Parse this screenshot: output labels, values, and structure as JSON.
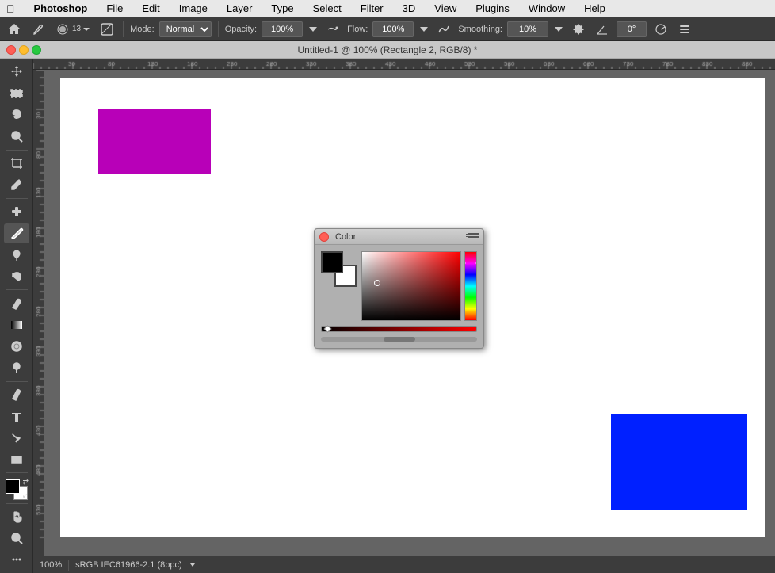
{
  "menubar": {
    "items": [
      "Photoshop",
      "File",
      "Edit",
      "Image",
      "Layer",
      "Type",
      "Select",
      "Filter",
      "3D",
      "View",
      "Plugins",
      "Window",
      "Help"
    ]
  },
  "optionsbar": {
    "brush_icon": "brush",
    "brush_size": "13",
    "mode_label": "Mode:",
    "mode_value": "Normal",
    "opacity_label": "Opacity:",
    "opacity_value": "100%",
    "flow_label": "Flow:",
    "flow_value": "100%",
    "smoothing_label": "Smoothing:",
    "smoothing_value": "10%",
    "angle_value": "0°"
  },
  "titlebar": {
    "title": "Untitled-1 @ 100% (Rectangle 2, RGB/8) *",
    "close": "×",
    "min": "–",
    "max": "+"
  },
  "statusbar": {
    "zoom": "100%",
    "color_profile": "sRGB IEC61966-2.1 (8bpc)"
  },
  "colorpanel": {
    "title": "Color",
    "close_btn": "×",
    "collapse_btn": "»",
    "fg_color": "#000000",
    "bg_color": "#ffffff",
    "spectrum_bottom_indicator": "◁"
  },
  "canvas": {
    "purple_rect": {
      "color": "#b800b8",
      "label": "purple rectangle"
    },
    "blue_rect": {
      "color": "#0020ff",
      "label": "blue rectangle"
    }
  },
  "toolbar": {
    "tools": [
      {
        "name": "move",
        "icon": "✥"
      },
      {
        "name": "marquee",
        "icon": "⬜"
      },
      {
        "name": "lasso",
        "icon": "⌀"
      },
      {
        "name": "quick-select",
        "icon": "⚡"
      },
      {
        "name": "crop",
        "icon": "⊹"
      },
      {
        "name": "eyedropper",
        "icon": "⌒"
      },
      {
        "name": "healing",
        "icon": "✚"
      },
      {
        "name": "brush",
        "icon": "🖌"
      },
      {
        "name": "clone-stamp",
        "icon": "✦"
      },
      {
        "name": "history-brush",
        "icon": "↩"
      },
      {
        "name": "eraser",
        "icon": "◻"
      },
      {
        "name": "gradient",
        "icon": "▣"
      },
      {
        "name": "blur",
        "icon": "◑"
      },
      {
        "name": "dodge",
        "icon": "○"
      },
      {
        "name": "pen",
        "icon": "✒"
      },
      {
        "name": "type",
        "icon": "T"
      },
      {
        "name": "path-select",
        "icon": "↖"
      },
      {
        "name": "shape",
        "icon": "□"
      },
      {
        "name": "hand",
        "icon": "✋"
      },
      {
        "name": "zoom",
        "icon": "🔍"
      },
      {
        "name": "more",
        "icon": "⋯"
      }
    ]
  }
}
